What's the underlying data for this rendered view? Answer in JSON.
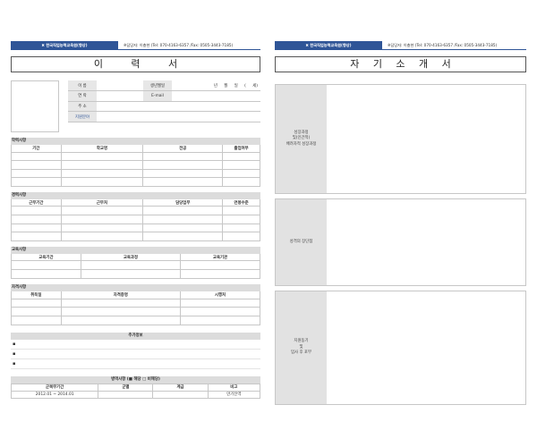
{
  "header": {
    "org": "✖ 한국직업능력교육원(향상)",
    "contact": "※담당자: 이충현 (Tel: 070-4163-6357 /Fax: 0505-3443-7185)"
  },
  "resume": {
    "title": "이 력 서",
    "personal": {
      "name_label": "이 름",
      "birth_label": "생년월일",
      "birth_placeholder": "년 월 일 ( 세)",
      "phone_label": "연 락",
      "email_label": "E-mail",
      "address_label": "주 소",
      "field_label": "지원분야"
    },
    "education": {
      "label": "학력사항",
      "headers": [
        "기간",
        "학교명",
        "전공",
        "졸업여부"
      ],
      "rows": [
        [
          "",
          "",
          "",
          ""
        ],
        [
          "",
          "",
          "",
          ""
        ],
        [
          "",
          "",
          "",
          ""
        ],
        [
          "",
          "",
          "",
          ""
        ]
      ]
    },
    "career": {
      "label": "경력사항",
      "headers": [
        "근무기간",
        "근무처",
        "담당업무",
        "연봉수준"
      ],
      "rows": [
        [
          "",
          "",
          "",
          ""
        ],
        [
          "",
          "",
          "",
          ""
        ],
        [
          "",
          "",
          "",
          ""
        ],
        [
          "",
          "",
          "",
          ""
        ]
      ]
    },
    "training": {
      "label": "교육사항",
      "headers": [
        "교육기간",
        "교육과정",
        "교육기관"
      ],
      "rows": [
        [
          "",
          "",
          ""
        ],
        [
          "",
          "",
          ""
        ]
      ]
    },
    "certificates": {
      "label": "자격사항",
      "headers": [
        "취득일",
        "자격증명",
        "시행처"
      ],
      "rows": [
        [
          "",
          "",
          ""
        ],
        [
          "",
          "",
          ""
        ],
        [
          "",
          "",
          ""
        ]
      ]
    },
    "additional": {
      "label": "추가정보",
      "bullets": [
        "▪",
        "▪",
        "▪"
      ]
    },
    "military": {
      "label": "병역사항 (■ 해당 □ 비해당)",
      "headers": [
        "군복무기간",
        "군별",
        "계급",
        "비고"
      ],
      "row": [
        "2012.01 ~ 2014.01",
        "",
        "",
        "만기전역"
      ]
    }
  },
  "intro": {
    "title": "자 기 소 개 서",
    "blocks": [
      {
        "label_lines": [
          "성장과정",
          "및(인간적)",
          "배려자적 성장과정"
        ]
      },
      {
        "label_lines": [
          "성격의 장단점"
        ]
      },
      {
        "label_lines": [
          "지원동기",
          "및",
          "입사 후 포부"
        ]
      }
    ]
  }
}
